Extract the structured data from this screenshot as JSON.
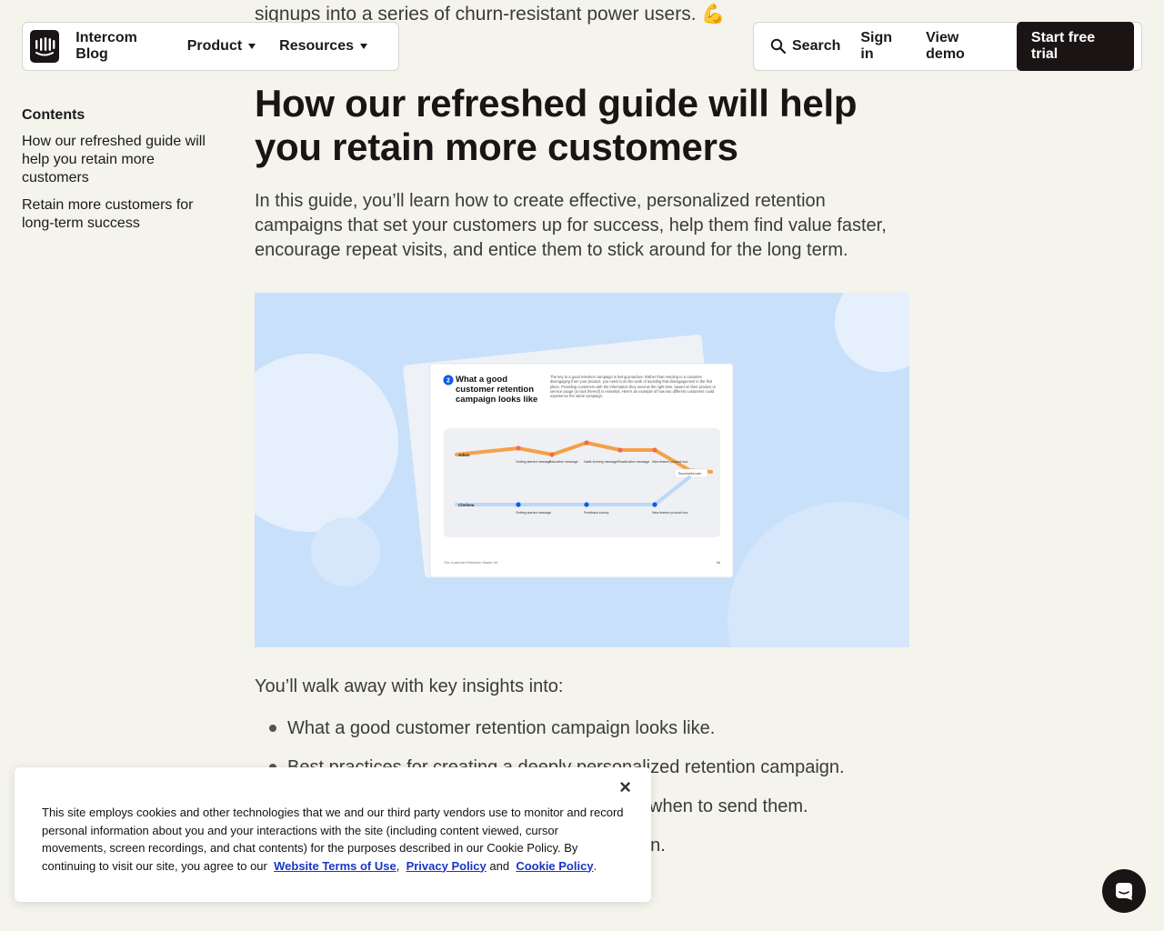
{
  "top_text": "signups into a series of churn-resistant power users. 💪",
  "nav": {
    "brand": "Intercom Blog",
    "product": "Product",
    "resources": "Resources",
    "search": "Search",
    "sign_in": "Sign in",
    "view_demo": "View demo",
    "cta": "Start free trial"
  },
  "toc": {
    "title": "Contents",
    "items": [
      "How our refreshed guide will help you retain more customers",
      "Retain more customers for long-term success"
    ]
  },
  "article": {
    "heading": "How our refreshed guide will help you retain more customers",
    "lead": "In this guide, you’ll learn how to create effective, personalized retention campaigns that set your customers up for success, help them find value faster, encourage repeat visits, and entice them to stick around for the long term.",
    "insights_intro": "You’ll walk away with key insights into:",
    "bullets": [
      "What a good customer retention campaign looks like.",
      "Best practices for creating a deeply personalized retention campaign.",
      "",
      ""
    ],
    "bullet3_tail": "l when to send them.",
    "bullet4_tail": "gn."
  },
  "hero": {
    "step": "2",
    "card_title": "What a good customer retention campaign looks like",
    "card_body": "The key to a good retention campaign is being proactive. Rather than reacting to a customer disengaging from your product, you need to do the work of avoiding that disengagement in the first place. Providing customers with the information they need at the right time, based on their product or service usage (or lack thereof) is essential. Here's an example of how two different customers could experience the same campaign.",
    "persona_a": "Adam",
    "persona_b": "Chelsea",
    "successful_user": "Successful user",
    "footer_left": "The Customer Retention Starter Kit",
    "footer_right": "04",
    "adam_steps": [
      "Getting started message",
      "Education message",
      "Habit-forming message",
      "Reactivation message",
      "New feature product tour"
    ],
    "chelsea_steps": [
      "Getting started message",
      "Feedback survey",
      "New feature product tour"
    ],
    "colors": {
      "orange": "#f5a048",
      "blue": "#0b5ce8",
      "light_blue": "#bcd9f7"
    }
  },
  "cookie": {
    "text": "This site employs cookies and other technologies that we and our third party vendors use to monitor and record personal information about you and your interactions with the site (including content viewed, cursor movements, screen recordings, and chat contents) for the purposes described in our Cookie Policy. By continuing to visit our site, you agree to our",
    "terms": "Website Terms of Use",
    "privacy": "Privacy Policy",
    "and": "and",
    "cookie_policy": "Cookie Policy",
    "close": "×"
  }
}
